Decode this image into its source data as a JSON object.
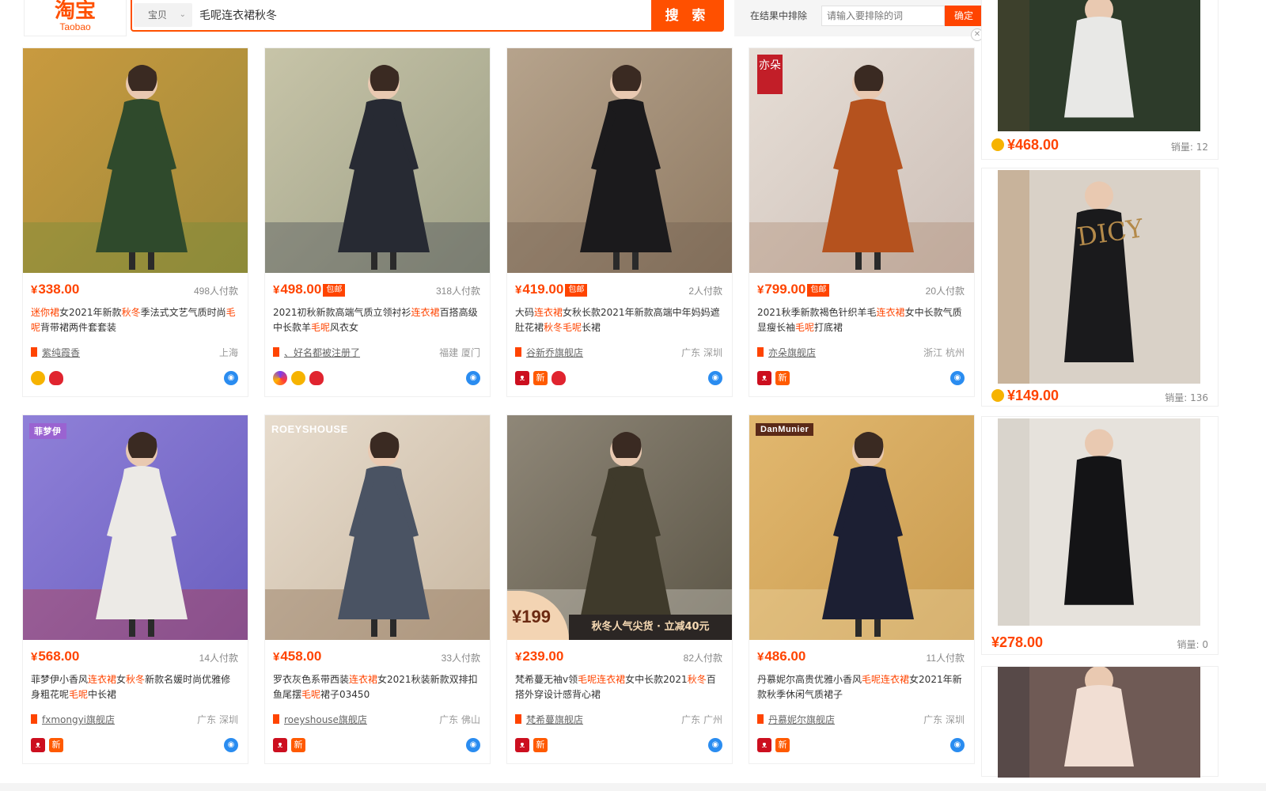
{
  "header": {
    "logo_cn": "淘宝",
    "logo_en": "Taobao",
    "search_scope": "宝贝",
    "search_query": "毛呢连衣裙秋冬",
    "search_button": "搜 索",
    "exclude_label": "在结果中排除",
    "exclude_placeholder": "请输入要排除的词",
    "exclude_ok": "确定"
  },
  "products": [
    {
      "price": "338.00",
      "sold": "498人付款",
      "bao": "",
      "title_parts": [
        [
          "迷你裙",
          true
        ],
        [
          "女2021年新款",
          false
        ],
        [
          "秋冬",
          true
        ],
        [
          "季法式文艺气质时尚",
          false
        ],
        [
          "毛呢",
          true
        ],
        [
          "背带裙两件套套装",
          false
        ]
      ],
      "title": "迷你裙女2021年新款秋冬季法式文艺气质时尚毛呢背带裙两件套套装",
      "shop": "紫纯霞香",
      "location": "上海",
      "icons": [
        "medal",
        "heart"
      ],
      "img_colors": [
        "#9e8a3a",
        "#c99a3f",
        "#2f4a2c",
        "#6d8b3a"
      ]
    },
    {
      "price": "498.00",
      "sold": "318人付款",
      "bao": "包邮",
      "title": "2021初秋新款高端气质立领衬衫连衣裙百搭高级中长款羊毛呢风衣女",
      "shop": "、好名都被注册了",
      "location": "福建 厦门",
      "icons": [
        "swirl",
        "medal",
        "heart"
      ],
      "img_colors": [
        "#9ea087",
        "#c7c4a8",
        "#272a33",
        "#3a3f4a"
      ]
    },
    {
      "price": "419.00",
      "sold": "2人付款",
      "bao": "包邮",
      "title": "大码连衣裙女秋长款2021年新款高端中年妈妈遮肚花裙秋冬毛呢长裙",
      "shop": "谷新乔旗舰店",
      "location": "广东 深圳",
      "icons": [
        "tmall",
        "xin",
        "heart"
      ],
      "img_colors": [
        "#8f7a63",
        "#b6a38c",
        "#1b1a1c",
        "#6b5a4b"
      ]
    },
    {
      "price": "799.00",
      "sold": "20人付款",
      "bao": "包邮",
      "title": "2021秋季新款褐色针织羊毛连衣裙女中长款气质显瘦长袖毛呢打底裙",
      "shop": "亦朵旗舰店",
      "location": "浙江 杭州",
      "icons": [
        "tmall",
        "xin"
      ],
      "img_colors": [
        "#cdbfb7",
        "#e6ded6",
        "#b5521e",
        "#a9836a"
      ],
      "stamp": "亦朵"
    },
    {
      "price": "568.00",
      "sold": "14人付款",
      "bao": "",
      "title": "菲梦伊小香风连衣裙女秋冬新款名媛时尚优雅修身粗花呢毛呢中长裙",
      "shop": "fxmongyi旗舰店",
      "location": "广东 深圳",
      "icons": [
        "tmall",
        "xin"
      ],
      "img_colors": [
        "#6a5fbf",
        "#8f80d8",
        "#eceae6",
        "#c7332b"
      ],
      "brand": "菲梦伊"
    },
    {
      "price": "458.00",
      "sold": "33人付款",
      "bao": "",
      "title": "罗衣灰色系带西装连衣裙女2021秋装新款双排扣鱼尾摆毛呢裙子03450",
      "shop": "roeyshouse旗舰店",
      "location": "广东 佛山",
      "icons": [
        "tmall",
        "xin"
      ],
      "img_colors": [
        "#c9b8a2",
        "#e7dccd",
        "#4a5363",
        "#7b5b3e"
      ],
      "brand": "ROEYSHOUSE"
    },
    {
      "price": "239.00",
      "sold": "82人付款",
      "bao": "",
      "title": "梵希蔓无袖v领毛呢连衣裙女中长款2021秋冬百搭外穿设计感背心裙",
      "shop": "梵希蔓旗舰店",
      "location": "广东 广州",
      "icons": [
        "tmall",
        "xin"
      ],
      "img_colors": [
        "#5b5546",
        "#8f8778",
        "#3f3a2b",
        "#e9e4dc"
      ],
      "promo_price": "¥199",
      "promo_text": "秋冬人气尖货 · 立减40元"
    },
    {
      "price": "486.00",
      "sold": "11人付款",
      "bao": "",
      "title": "丹慕妮尔高贵优雅小香风毛呢连衣裙女2021年新款秋季休闲气质裙子",
      "shop": "丹慕妮尔旗舰店",
      "location": "广东 深圳",
      "icons": [
        "tmall",
        "xin"
      ],
      "img_colors": [
        "#c99b4f",
        "#e2b86f",
        "#1c1f33",
        "#f2ddb0"
      ],
      "brand": "DanMunier"
    }
  ],
  "right_column": [
    {
      "price": "¥468.00",
      "sold": "销量: 12",
      "img_colors": [
        "#2d3b2a",
        "#e8e8e6",
        "#5d4a32"
      ]
    },
    {
      "price": "¥149.00",
      "sold": "销量: 136",
      "img_colors": [
        "#d9d1c7",
        "#1a1a1c",
        "#a87c4a"
      ],
      "overlay": "DICY"
    },
    {
      "price": "¥278.00",
      "sold": "销量: 0",
      "img_colors": [
        "#e6e2dc",
        "#141416",
        "#bfb9af"
      ]
    },
    {
      "price": "",
      "sold": "",
      "img_colors": [
        "#6f5a55",
        "#f1ded3",
        "#2a2a30"
      ]
    }
  ]
}
